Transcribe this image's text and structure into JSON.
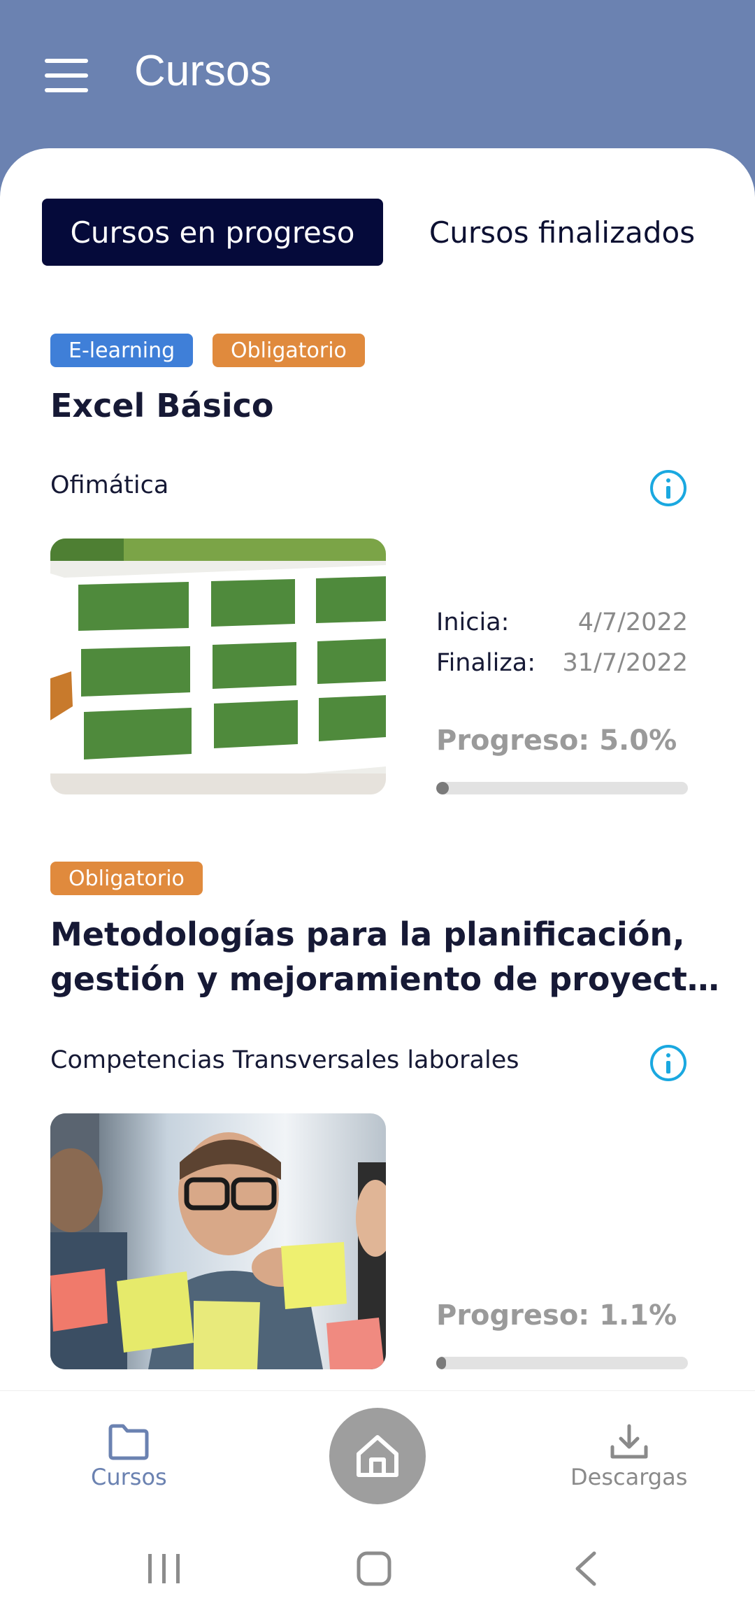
{
  "header": {
    "title": "Cursos"
  },
  "tabs": {
    "active": "Cursos en progreso",
    "inactive": "Cursos finalizados"
  },
  "courses": [
    {
      "badges": [
        "E-learning",
        "Obligatorio"
      ],
      "title": "Excel Básico",
      "category": "Ofimática",
      "start_label": "Inicia:",
      "start_date": "4/7/2022",
      "end_label": "Finaliza:",
      "end_date": "31/7/2022",
      "progress_text": "Progreso: 5.0%",
      "progress_value": 5.0
    },
    {
      "badges": [
        "Obligatorio"
      ],
      "title_line1": "Metodologías para la planificación,",
      "title_line2": "gestión y mejoramiento de proyect…",
      "category": "Competencias Transversales laborales",
      "progress_text": "Progreso: 1.1%",
      "progress_value": 1.1
    }
  ],
  "bottom_nav": {
    "courses_label": "Cursos",
    "downloads_label": "Descargas"
  },
  "colors": {
    "header": "#6b82b1",
    "tab_active": "#050a3a",
    "badge_blue": "#3f7fd8",
    "badge_orange": "#e08a3d",
    "info": "#1aa8e0"
  }
}
